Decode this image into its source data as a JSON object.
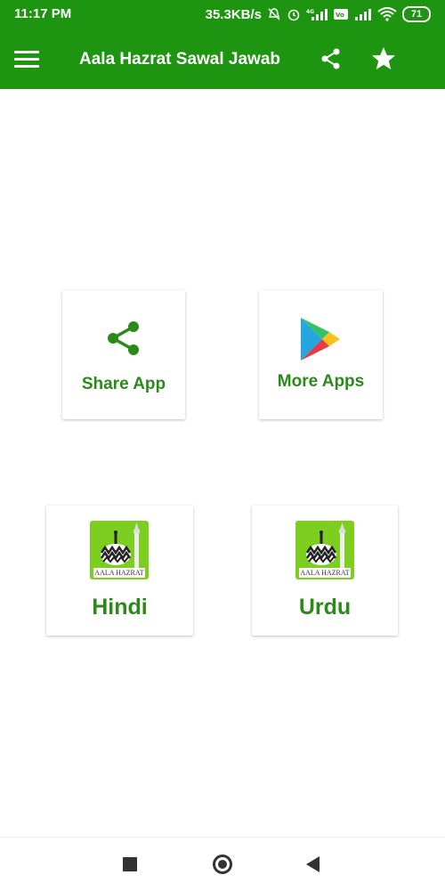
{
  "status_bar": {
    "time": "11:17 PM",
    "network_speed": "35.3KB/s",
    "battery": "71"
  },
  "app_bar": {
    "title": "Aala Hazrat Sawal Jawab",
    "menu_icon": "menu-icon",
    "share_icon": "share-icon",
    "star_icon": "star-icon"
  },
  "cards": {
    "share_app": {
      "label": "Share App",
      "icon": "share-icon"
    },
    "more_apps": {
      "label": "More Apps",
      "icon": "play-store-icon"
    },
    "hindi": {
      "label": "Hindi",
      "icon": "aala-hazrat-logo",
      "logo_text": "AALA HAZRAT"
    },
    "urdu": {
      "label": "Urdu",
      "icon": "aala-hazrat-logo",
      "logo_text": "AALA HAZRAT"
    }
  },
  "colors": {
    "app_bar": "#1d9510",
    "card_label": "#2b8a1a",
    "logo_background": "#7ccf1e"
  },
  "nav_bar": {
    "recents_icon": "square-icon",
    "home_icon": "circle-icon",
    "back_icon": "back-triangle-icon"
  }
}
